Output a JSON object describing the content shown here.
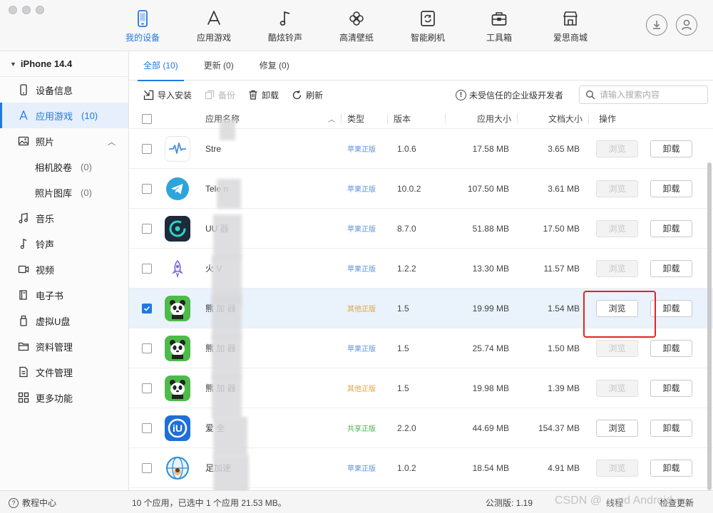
{
  "nav": {
    "tabs": [
      {
        "label": "我的设备",
        "icon": "phone-icon"
      },
      {
        "label": "应用游戏",
        "icon": "app-store-icon"
      },
      {
        "label": "酷炫铃声",
        "icon": "music-note-icon"
      },
      {
        "label": "高清壁纸",
        "icon": "flower-icon"
      },
      {
        "label": "智能刷机",
        "icon": "refresh-phone-icon"
      },
      {
        "label": "工具箱",
        "icon": "toolbox-icon"
      },
      {
        "label": "爱思商城",
        "icon": "store-icon"
      }
    ],
    "accent": "#1f7ae0"
  },
  "sidebar": {
    "device_name": "iPhone 14.4",
    "items": [
      {
        "label": "设备信息",
        "count": ""
      },
      {
        "label": "应用游戏",
        "count": "(10)"
      },
      {
        "label": "照片",
        "count": ""
      },
      {
        "label": "相机胶卷",
        "count": "(0)"
      },
      {
        "label": "照片图库",
        "count": "(0)"
      },
      {
        "label": "音乐",
        "count": ""
      },
      {
        "label": "铃声",
        "count": ""
      },
      {
        "label": "视频",
        "count": ""
      },
      {
        "label": "电子书",
        "count": ""
      },
      {
        "label": "虚拟U盘",
        "count": ""
      },
      {
        "label": "资料管理",
        "count": ""
      },
      {
        "label": "文件管理",
        "count": ""
      },
      {
        "label": "更多功能",
        "count": ""
      }
    ]
  },
  "subtabs": [
    {
      "label": "全部 (10)"
    },
    {
      "label": "更新 (0)"
    },
    {
      "label": "修复 (0)"
    }
  ],
  "toolbar": {
    "import": "导入安装",
    "backup": "备份",
    "uninstall": "卸载",
    "refresh": "刷新",
    "warning": "未受信任的企业级开发者",
    "search_placeholder": "请输入搜索内容"
  },
  "table": {
    "headers": {
      "name": "应用名称",
      "type": "类型",
      "version": "版本",
      "app_size": "应用大小",
      "doc_size": "文档大小",
      "ops": "操作"
    },
    "rows": [
      {
        "name": "Stre",
        "type": "苹果正版",
        "type_color": "#5b93d9",
        "version": "1.0.6",
        "app_size": "17.58 MB",
        "doc_size": "3.65 MB",
        "browse": "浏览",
        "browse_enabled": false,
        "uninstall": "卸载",
        "checked": false
      },
      {
        "name": "Tele      n",
        "type": "苹果正版",
        "type_color": "#5b93d9",
        "version": "10.0.2",
        "app_size": "107.50 MB",
        "doc_size": "3.61 MB",
        "browse": "浏览",
        "browse_enabled": false,
        "uninstall": "卸载",
        "checked": false
      },
      {
        "name": "UU      器",
        "type": "苹果正版",
        "type_color": "#5b93d9",
        "version": "8.7.0",
        "app_size": "51.88 MB",
        "doc_size": "17.50 MB",
        "browse": "浏览",
        "browse_enabled": false,
        "uninstall": "卸载",
        "checked": false
      },
      {
        "name": "火    V",
        "type": "苹果正版",
        "type_color": "#5b93d9",
        "version": "1.2.2",
        "app_size": "13.30 MB",
        "doc_size": "11.57 MB",
        "browse": "浏览",
        "browse_enabled": false,
        "uninstall": "卸载",
        "checked": false
      },
      {
        "name": "熊   加   器",
        "type": "其他正版",
        "type_color": "#e4a23a",
        "version": "1.5",
        "app_size": "19.99 MB",
        "doc_size": "1.54 MB",
        "browse": "浏览",
        "browse_enabled": true,
        "uninstall": "卸载",
        "checked": true
      },
      {
        "name": "熊   加   器",
        "type": "苹果正版",
        "type_color": "#5b93d9",
        "version": "1.5",
        "app_size": "25.74 MB",
        "doc_size": "1.50 MB",
        "browse": "浏览",
        "browse_enabled": false,
        "uninstall": "卸载",
        "checked": false
      },
      {
        "name": "熊   加   器",
        "type": "其他正版",
        "type_color": "#e4a23a",
        "version": "1.5",
        "app_size": "19.98 MB",
        "doc_size": "1.39 MB",
        "browse": "浏览",
        "browse_enabled": false,
        "uninstall": "卸载",
        "checked": false
      },
      {
        "name": "爱      全   ",
        "type": "共享正版",
        "type_color": "#4caf50",
        "version": "2.2.0",
        "app_size": "44.69 MB",
        "doc_size": "154.37 MB",
        "browse": "浏览",
        "browse_enabled": true,
        "uninstall": "卸载",
        "checked": false
      },
      {
        "name": "   足加速",
        "type": "苹果正版",
        "type_color": "#5b93d9",
        "version": "1.0.2",
        "app_size": "18.54 MB",
        "doc_size": "4.91 MB",
        "browse": "浏览",
        "browse_enabled": false,
        "uninstall": "卸载",
        "checked": false
      }
    ]
  },
  "status": {
    "help": "教程中心",
    "summary": "10 个应用，已选中 1 个应用 21.53 MB。",
    "version": "公测版: 1.19",
    "extra": "线程",
    "extra2": "检查更新",
    "watermark": "CSDN @ ...  nd Android"
  }
}
